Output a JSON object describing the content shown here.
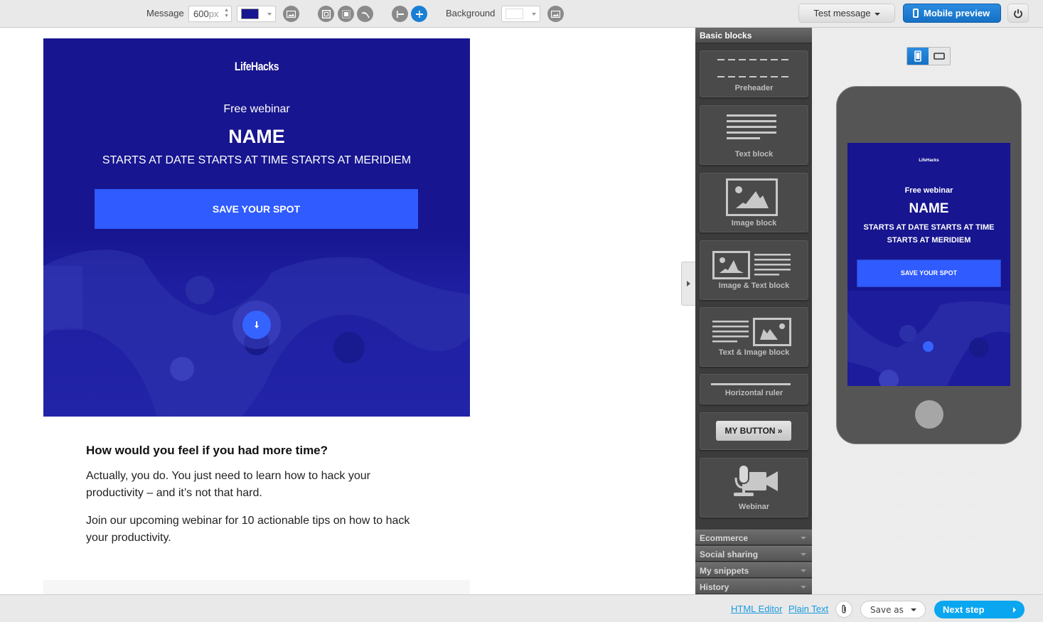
{
  "toolbar": {
    "message_label": "Message",
    "width_value": "600",
    "width_unit": "px",
    "message_color": "#17158f",
    "background_label": "Background",
    "background_color": "#ffffff",
    "test_message_label": "Test message",
    "mobile_preview_label": "Mobile preview"
  },
  "email": {
    "logo": "LifeHacks",
    "subtitle": "Free webinar",
    "name": "NAME",
    "when": "STARTS AT DATE STARTS AT TIME STARTS AT MERIDIEM",
    "cta": "SAVE YOUR SPOT",
    "heading": "How would you feel if you had more time?",
    "paragraphs": [
      "Actually, you do. You just need to learn how to hack your productivity – and it’s not that hard.",
      "Join our upcoming webinar for 10 actionable tips on how to hack your productivity."
    ],
    "bg_color": "#17158f",
    "cta_color": "#2f5bff"
  },
  "blocks_panel": {
    "title": "Basic blocks",
    "items": [
      {
        "label": "Preheader"
      },
      {
        "label": "Text block"
      },
      {
        "label": "Image block"
      },
      {
        "label": "Image & Text block"
      },
      {
        "label": "Text & Image block"
      },
      {
        "label": "Horizontal ruler"
      },
      {
        "label": "MY BUTTON »"
      },
      {
        "label": "Webinar"
      }
    ],
    "sections": [
      {
        "label": "Ecommerce"
      },
      {
        "label": "Social sharing"
      },
      {
        "label": "My snippets"
      },
      {
        "label": "History"
      }
    ]
  },
  "preview": {
    "logo": "LifeHacks",
    "subtitle": "Free webinar",
    "name": "NAME",
    "when": "STARTS AT DATE STARTS AT TIME STARTS AT MERIDIEM",
    "cta": "SAVE YOUR SPOT",
    "orientation": "portrait"
  },
  "footer": {
    "html_editor": "HTML Editor",
    "plain_text": "Plain Text",
    "save_as": "Save as",
    "next_step": "Next step"
  }
}
